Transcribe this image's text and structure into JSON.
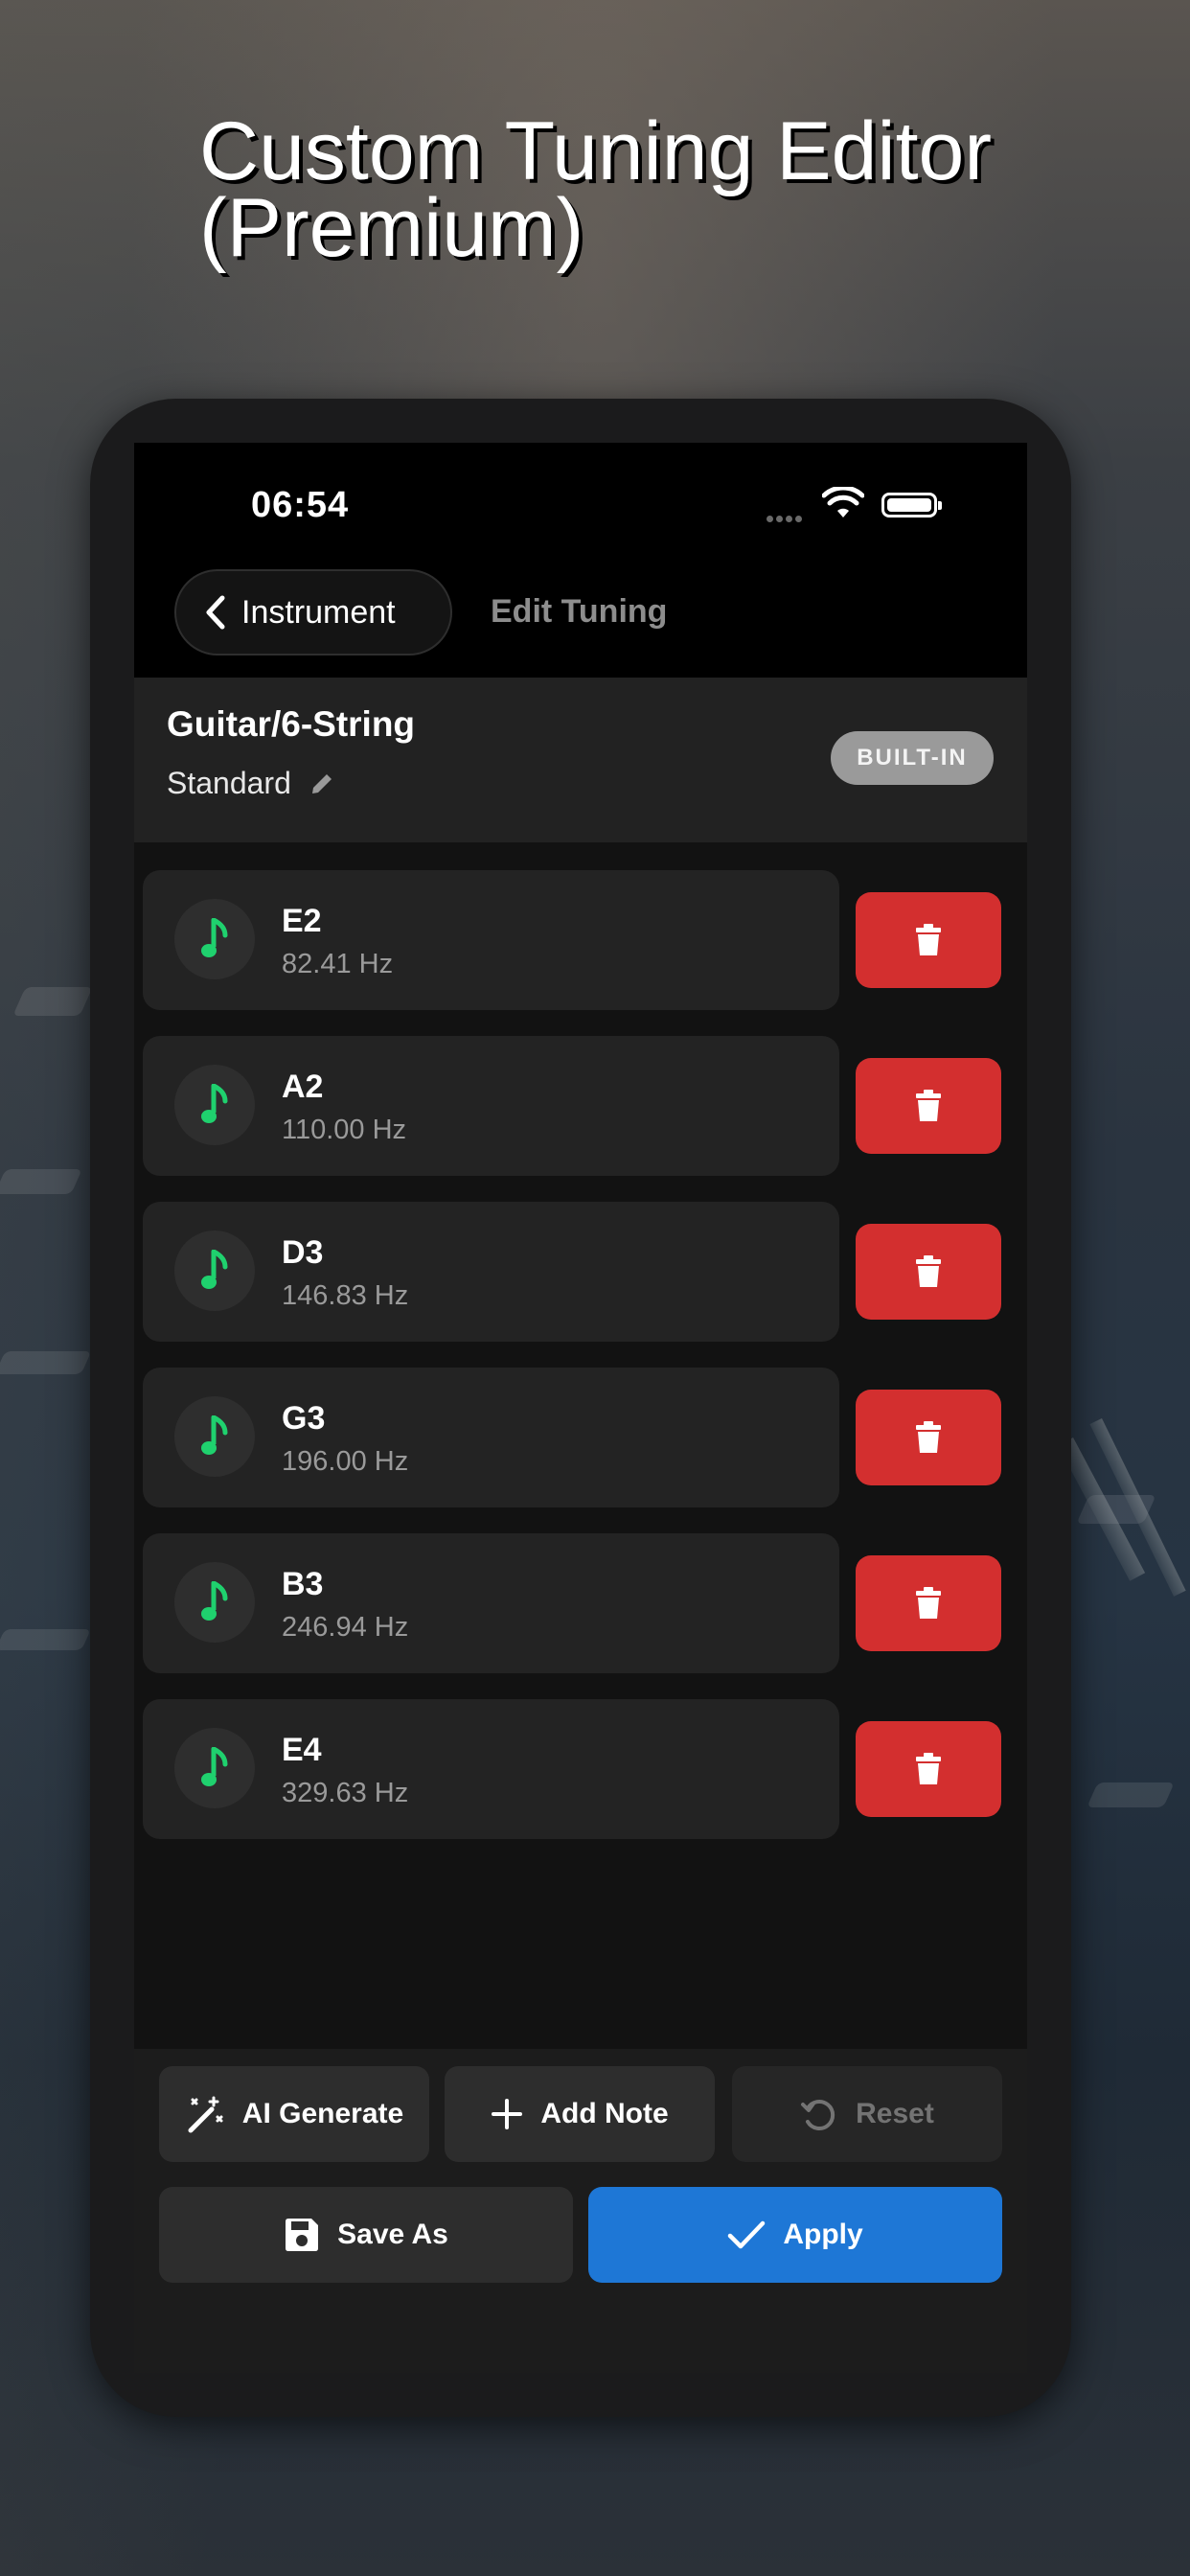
{
  "headline": "Custom Tuning Editor (Premium)",
  "status_bar": {
    "time": "06:54"
  },
  "nav": {
    "back_label": "Instrument",
    "title": "Edit Tuning"
  },
  "tuning_info": {
    "instrument": "Guitar/6-String",
    "tuning_name": "Standard",
    "badge": "BUILT-IN"
  },
  "notes": [
    {
      "name": "E2",
      "freq": "82.41 Hz"
    },
    {
      "name": "A2",
      "freq": "110.00 Hz"
    },
    {
      "name": "D3",
      "freq": "146.83 Hz"
    },
    {
      "name": "G3",
      "freq": "196.00 Hz"
    },
    {
      "name": "B3",
      "freq": "246.94 Hz"
    },
    {
      "name": "E4",
      "freq": "329.63 Hz"
    }
  ],
  "actions": {
    "ai_generate": "AI Generate",
    "add_note": "Add Note",
    "reset": "Reset",
    "save_as": "Save As",
    "apply": "Apply"
  },
  "colors": {
    "accent_blue": "#1e77d6",
    "delete_red": "#d32f2f",
    "note_green": "#1fd16e",
    "badge_gray": "#9a9a9a"
  },
  "icons": [
    "chevron-left-icon",
    "wifi-icon",
    "battery-icon",
    "pencil-icon",
    "music-note-icon",
    "trash-icon",
    "magic-wand-icon",
    "plus-icon",
    "reset-icon",
    "floppy-disk-icon",
    "checkmark-icon"
  ]
}
